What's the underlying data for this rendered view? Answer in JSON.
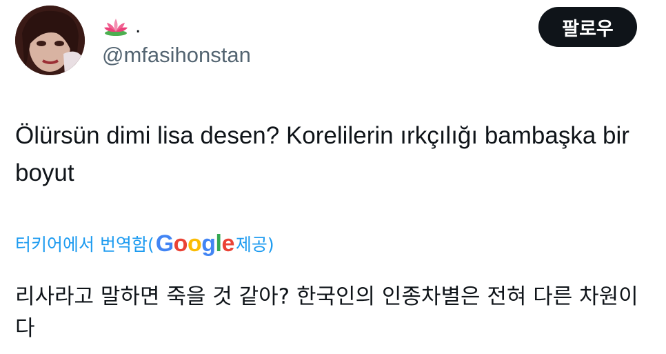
{
  "author": {
    "display_name_suffix": ".",
    "display_name_icon": "lotus-icon",
    "handle": "@mfasihonstan"
  },
  "follow_button": {
    "label": "팔로우"
  },
  "tweet": {
    "text": "Ölürsün dimi lisa desen?  Korelilerin ırkçılığı bambaşka bir boyut"
  },
  "translation": {
    "prefix": "터키어에서 번역함(",
    "provider_letters": [
      "G",
      "o",
      "o",
      "g",
      "l",
      "e"
    ],
    "suffix": " 제공)",
    "text": "리사라고 말하면 죽을 것 같아? 한국인의 인종차별은 전혀 다른 차원이다"
  },
  "colors": {
    "text": "#0f1419",
    "secondary": "#536471",
    "link": "#1d9bf0",
    "button_bg": "#0f1419"
  }
}
